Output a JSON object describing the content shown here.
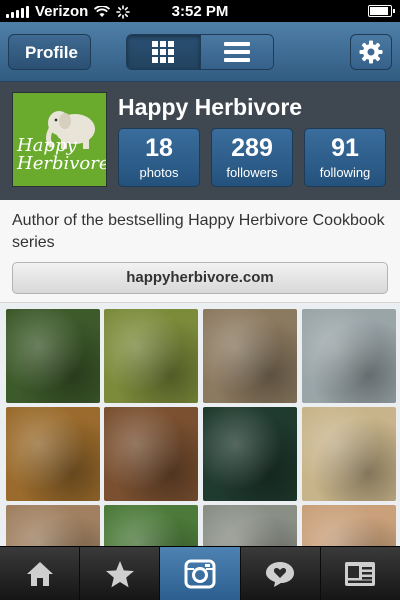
{
  "status_bar": {
    "carrier": "Verizon",
    "time": "3:52 PM"
  },
  "nav": {
    "back_label": "Profile",
    "view_toggle": [
      "grid-icon",
      "list-icon"
    ],
    "settings_icon": "gear-icon",
    "accent": "#3e6e99"
  },
  "profile": {
    "username": "Happy Herbivore",
    "avatar_text": "Happy Herbivore",
    "stats": [
      {
        "value": "18",
        "label": "photos"
      },
      {
        "value": "289",
        "label": "followers"
      },
      {
        "value": "91",
        "label": "following"
      }
    ],
    "bio": "Author of the bestselling Happy Herbivore Cookbook series",
    "website": "happyherbivore.com"
  },
  "photo_grid": [
    {
      "subject": "spinach greens plate",
      "color": "#3d5a2a"
    },
    {
      "subject": "salad with dressing",
      "color": "#7b8b3a"
    },
    {
      "subject": "plated salads",
      "color": "#8c7a60"
    },
    {
      "subject": "food display case",
      "color": "#9aa5a8"
    },
    {
      "subject": "vegetable rice plate",
      "color": "#9a6b2c"
    },
    {
      "subject": "muffin",
      "color": "#7a5030"
    },
    {
      "subject": "baseball stadium night",
      "color": "#1f3a2e"
    },
    {
      "subject": "noodle salad",
      "color": "#c8b48a"
    },
    {
      "subject": "baked dish",
      "color": "#a08060"
    },
    {
      "subject": "ballpark field",
      "color": "#4c7a3a"
    },
    {
      "subject": "street people",
      "color": "#8a8f86"
    },
    {
      "subject": "dessert plate",
      "color": "#c9a07a"
    }
  ],
  "tab_bar": [
    {
      "icon": "home-icon",
      "active": false
    },
    {
      "icon": "star-icon",
      "active": false
    },
    {
      "icon": "camera-icon",
      "active": true
    },
    {
      "icon": "heart-speech-icon",
      "active": false
    },
    {
      "icon": "profile-card-icon",
      "active": false
    }
  ]
}
